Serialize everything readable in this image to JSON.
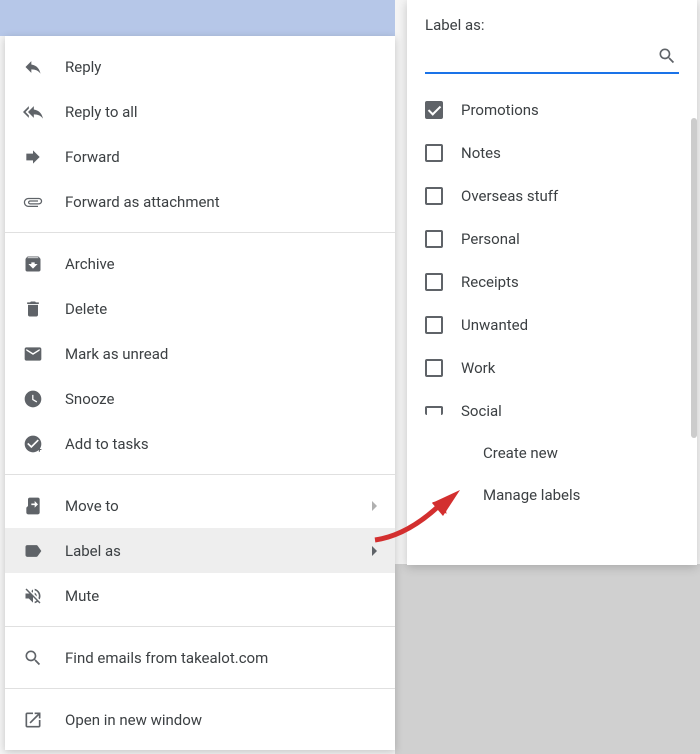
{
  "contextMenu": {
    "reply": "Reply",
    "replyAll": "Reply to all",
    "forward": "Forward",
    "forwardAttach": "Forward as attachment",
    "archive": "Archive",
    "delete": "Delete",
    "markUnread": "Mark as unread",
    "snooze": "Snooze",
    "addTasks": "Add to tasks",
    "moveTo": "Move to",
    "labelAs": "Label as",
    "mute": "Mute",
    "findEmails": "Find emails from takealot.com",
    "openNewWindow": "Open in new window"
  },
  "labelPanel": {
    "title": "Label as:",
    "searchPlaceholder": "",
    "labels": [
      {
        "name": "Promotions",
        "checked": true
      },
      {
        "name": "Notes",
        "checked": false
      },
      {
        "name": "Overseas stuff",
        "checked": false
      },
      {
        "name": "Personal",
        "checked": false
      },
      {
        "name": "Receipts",
        "checked": false
      },
      {
        "name": "Unwanted",
        "checked": false
      },
      {
        "name": "Work",
        "checked": false
      },
      {
        "name": "Social",
        "checked": false
      }
    ],
    "createNew": "Create new",
    "manageLabels": "Manage labels"
  }
}
